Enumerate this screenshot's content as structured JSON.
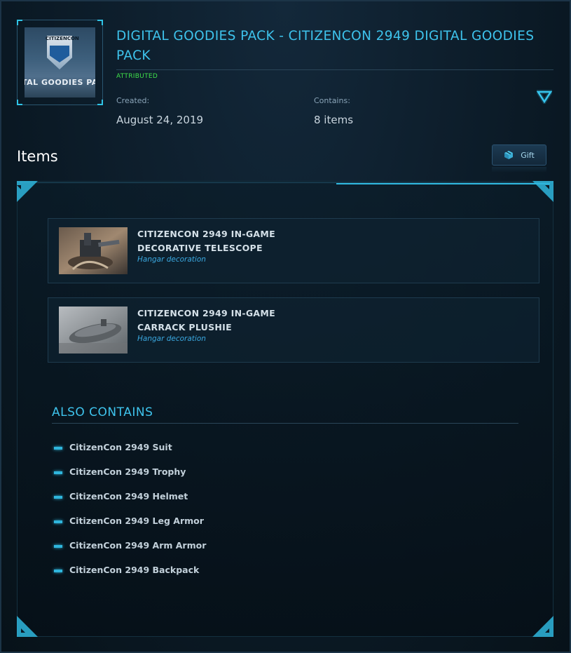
{
  "pack": {
    "title": "DIGITAL GOODIES PACK - CITIZENCON 2949 DIGITAL GOODIES PACK",
    "status": "ATTRIBUTED",
    "thumbnail_text": "TAL GOODIES PA",
    "thumbnail_logo_text": "CITIZENCON",
    "created_label": "Created:",
    "created_value": "August 24, 2019",
    "contains_label": "Contains:",
    "contains_value": "8 items"
  },
  "items_section": {
    "heading": "Items",
    "gift_label": "Gift",
    "items": [
      {
        "name_line1": "CITIZENCON 2949 IN-GAME",
        "name_line2": "DECORATIVE TELESCOPE",
        "kind": "Hangar decoration"
      },
      {
        "name_line1": "CITIZENCON 2949 IN-GAME",
        "name_line2": "CARRACK PLUSHIE",
        "kind": "Hangar decoration"
      }
    ]
  },
  "also_contains": {
    "title": "ALSO CONTAINS",
    "items": [
      "CitizenCon 2949 Suit",
      "CitizenCon 2949 Trophy",
      "CitizenCon 2949 Helmet",
      "CitizenCon 2949 Leg Armor",
      "CitizenCon 2949 Arm Armor",
      "CitizenCon 2949 Backpack"
    ]
  },
  "colors": {
    "accent": "#3ec3ec",
    "status_green": "#3fe04a",
    "background": "#0b1a26"
  },
  "icons": [
    "collapse-triangle-icon",
    "gift-cube-icon",
    "bullet-dash-icon"
  ]
}
